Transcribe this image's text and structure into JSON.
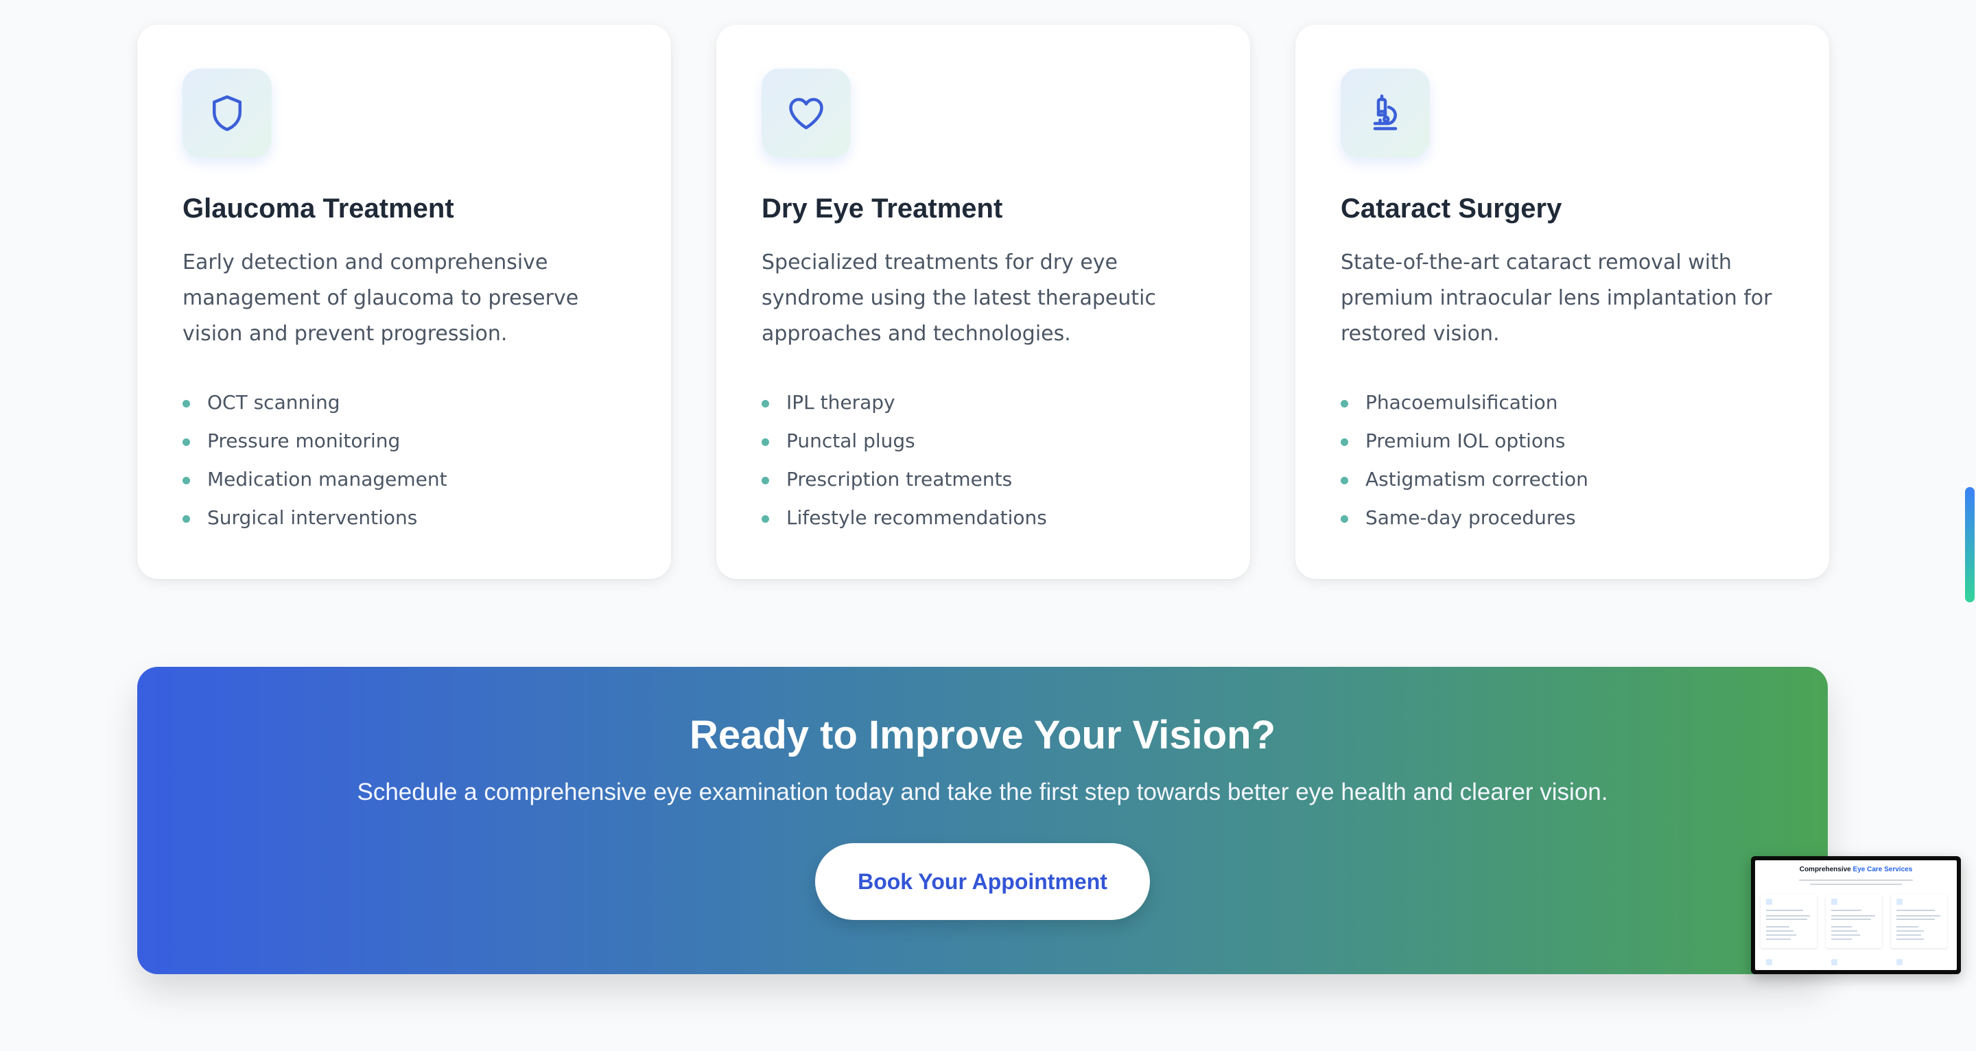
{
  "services": [
    {
      "icon": "shield-icon",
      "title": "Glaucoma Treatment",
      "description": "Early detection and comprehensive management of glaucoma to preserve vision and prevent progression.",
      "features": [
        "OCT scanning",
        "Pressure monitoring",
        "Medication management",
        "Surgical interventions"
      ]
    },
    {
      "icon": "heart-icon",
      "title": "Dry Eye Treatment",
      "description": "Specialized treatments for dry eye syndrome using the latest therapeutic approaches and technologies.",
      "features": [
        "IPL therapy",
        "Punctal plugs",
        "Prescription treatments",
        "Lifestyle recommendations"
      ]
    },
    {
      "icon": "microscope-icon",
      "title": "Cataract Surgery",
      "description": "State-of-the-art cataract removal with premium intraocular lens implantation for restored vision.",
      "features": [
        "Phacoemulsification",
        "Premium IOL options",
        "Astigmatism correction",
        "Same-day procedures"
      ]
    }
  ],
  "cta": {
    "title": "Ready to Improve Your Vision?",
    "subtitle": "Schedule a comprehensive eye examination today and take the first step towards better eye health and clearer vision.",
    "button_label": "Book Your Appointment"
  },
  "preview": {
    "title_plain": "Comprehensive",
    "title_highlight": "Eye Care Services"
  },
  "colors": {
    "accent_blue": "#3355d6",
    "gradient_start": "#385fe0",
    "gradient_end": "#4ba456",
    "bullet": "#5bb5a8"
  }
}
